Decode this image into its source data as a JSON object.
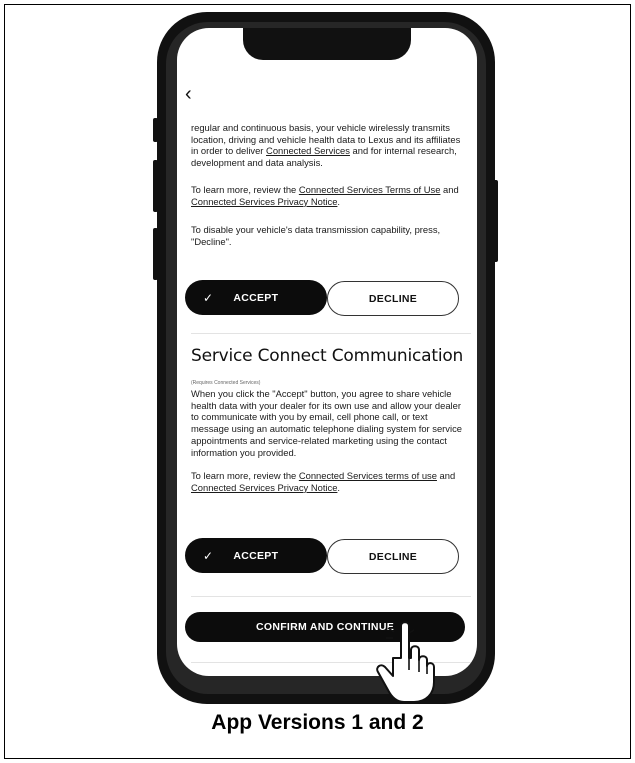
{
  "screen": {
    "back_icon": "chevron-left-icon",
    "intro_paragraph": {
      "lead": "regular and continuous basis, your vehicle wirelessly transmits location, driving and vehicle health data to Lexus and its affiliates in order to deliver ",
      "link": "Connected Services",
      "tail": " and for internal research, development and data analysis."
    },
    "learn_more_1": {
      "lead": "To learn more, review the ",
      "link1": "Connected Services Terms of Use",
      "mid": " and ",
      "link2": "Connected Services Privacy Notice",
      "tail": "."
    },
    "disable_text": "To disable your vehicle's data transmission capability, press, \"Decline\".",
    "accept_label": "ACCEPT",
    "decline_label": "DECLINE",
    "check_icon": "checkmark-icon",
    "section2": {
      "title": "Service Connect Communication",
      "requires": "(Requires Connected Services)",
      "body": "When you click the \"Accept\" button, you agree to share vehicle health data with your dealer for its own use and allow your dealer to communicate with you by email, cell phone call, or text message using an automatic telephone dialing system for service appointments and service-related marketing using the contact information you provided.",
      "learn_lead": "To learn more, review the ",
      "learn_link1": "Connected Services terms of use",
      "learn_mid": " and ",
      "learn_link2": "Connected Services Privacy Notice",
      "learn_tail": ".",
      "accept_label": "ACCEPT",
      "decline_label": "DECLINE"
    },
    "confirm_label": "CONFIRM AND CONTINUE"
  },
  "caption": "App Versions 1 and 2",
  "pointer_icon": "hand-pointer-icon"
}
